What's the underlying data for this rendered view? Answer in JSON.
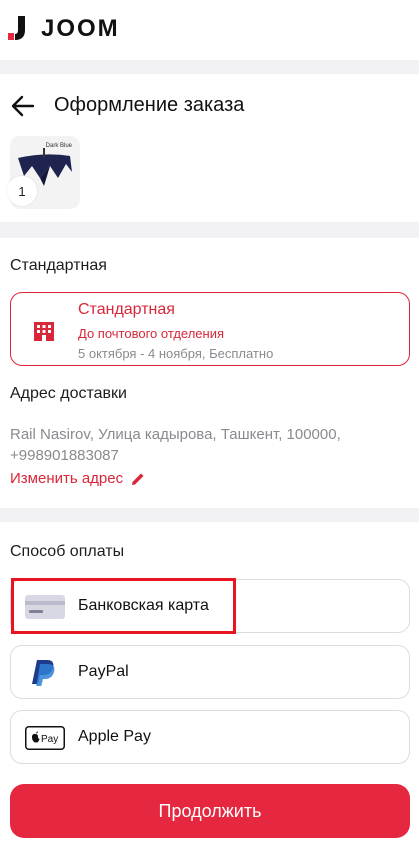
{
  "app": {
    "logo_text": "JOOM",
    "accent": "#e5283f"
  },
  "header": {
    "title": "Оформление заказа"
  },
  "order": {
    "item_quantity": "1",
    "item_caption": "Dark Blue"
  },
  "delivery": {
    "section_label": "Стандартная",
    "option": {
      "name": "Стандартная",
      "subtitle": "До почтового отделения",
      "dates": "5 октября - 4 ноября, Бесплатно"
    },
    "address_label": "Адрес доставки",
    "address": "Rail Nasirov, Улица кадырова, Ташкент, 100000, +998901883087",
    "change_address": "Изменить адрес"
  },
  "payment": {
    "section_label": "Способ оплаты",
    "methods": [
      {
        "label": "Банковская карта",
        "icon": "credit-card-icon"
      },
      {
        "label": "PayPal",
        "icon": "paypal-icon"
      },
      {
        "label": "Apple Pay",
        "icon": "apple-pay-icon",
        "badge": "Pay"
      }
    ]
  },
  "actions": {
    "continue_label": "Продолжить"
  }
}
